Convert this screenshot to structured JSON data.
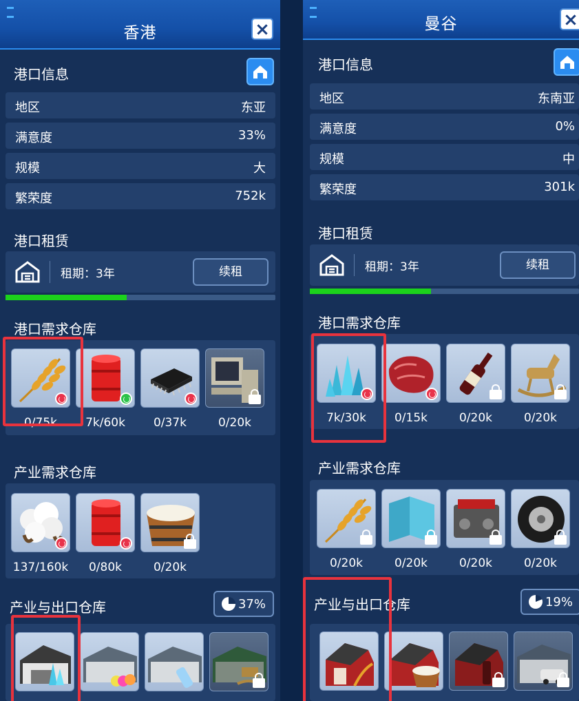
{
  "left": {
    "title": "香港",
    "close_icon": "×",
    "port_info_title": "港口信息",
    "info_rows": [
      {
        "label": "地区",
        "value": "东亚"
      },
      {
        "label": "满意度",
        "value": "33%"
      },
      {
        "label": "规模",
        "value": "大"
      },
      {
        "label": "繁荣度",
        "value": "752k"
      }
    ],
    "lease_title": "港口租赁",
    "lease_term": "租期：3年",
    "renew_label": "续租",
    "lease_progress": 0.45,
    "port_demand_title": "港口需求仓库",
    "port_demand": [
      {
        "icon": "wheat-icon",
        "qty": "0/75k",
        "status": "sad"
      },
      {
        "icon": "oil-barrel-icon",
        "qty": "7k/60k",
        "status": "happy"
      },
      {
        "icon": "microchip-icon",
        "qty": "0/37k",
        "status": "sad"
      },
      {
        "icon": "computer-icon",
        "qty": "0/20k",
        "status": "locked"
      }
    ],
    "industry_demand_title": "产业需求仓库",
    "industry_demand": [
      {
        "icon": "cotton-icon",
        "qty": "137/160k",
        "status": "sad"
      },
      {
        "icon": "oil-barrel-icon",
        "qty": "0/80k",
        "status": "sad"
      },
      {
        "icon": "milk-bucket-icon",
        "qty": "0/20k",
        "status": "locked"
      }
    ],
    "export_title": "产业与出口仓库",
    "export_pct": "37%",
    "export": [
      {
        "icon": "crystal-factory-icon"
      },
      {
        "icon": "textile-factory-icon"
      },
      {
        "icon": "plastic-factory-icon"
      },
      {
        "icon": "toy-factory-icon",
        "status": "locked"
      }
    ]
  },
  "right": {
    "title": "曼谷",
    "close_icon": "×",
    "port_info_title": "港口信息",
    "info_rows": [
      {
        "label": "地区",
        "value": "东南亚"
      },
      {
        "label": "满意度",
        "value": "0%"
      },
      {
        "label": "规模",
        "value": "中"
      },
      {
        "label": "繁荣度",
        "value": "301k"
      }
    ],
    "lease_title": "港口租赁",
    "lease_term": "租期：3年",
    "renew_label": "续租",
    "lease_progress": 0.45,
    "port_demand_title": "港口需求仓库",
    "port_demand": [
      {
        "icon": "crystal-icon",
        "qty": "7k/30k",
        "status": "sad"
      },
      {
        "icon": "meat-icon",
        "qty": "0/15k",
        "status": "sad"
      },
      {
        "icon": "wine-bottle-icon",
        "qty": "0/20k",
        "status": "locked"
      },
      {
        "icon": "rocking-horse-icon",
        "qty": "0/20k",
        "status": "locked"
      }
    ],
    "industry_demand_title": "产业需求仓库",
    "industry_demand": [
      {
        "icon": "wheat-icon",
        "qty": "0/20k",
        "status": "locked"
      },
      {
        "icon": "glass-panel-icon",
        "qty": "0/20k",
        "status": "locked"
      },
      {
        "icon": "engine-icon",
        "qty": "0/20k",
        "status": "locked"
      },
      {
        "icon": "tire-icon",
        "qty": "0/20k",
        "status": "locked"
      }
    ],
    "export_title": "产业与出口仓库",
    "export_pct": "19%",
    "export": [
      {
        "icon": "farm-barn-icon"
      },
      {
        "icon": "dairy-barn-icon"
      },
      {
        "icon": "winery-barn-icon",
        "status": "locked"
      },
      {
        "icon": "car-factory-icon",
        "status": "locked"
      }
    ]
  },
  "colors": {
    "panel": "#163058",
    "header": "#1450a8",
    "row": "#23406c",
    "progress": "#1cd21c",
    "highlight": "#e8333d",
    "sad": "#e8334a",
    "happy": "#2cc24a"
  }
}
